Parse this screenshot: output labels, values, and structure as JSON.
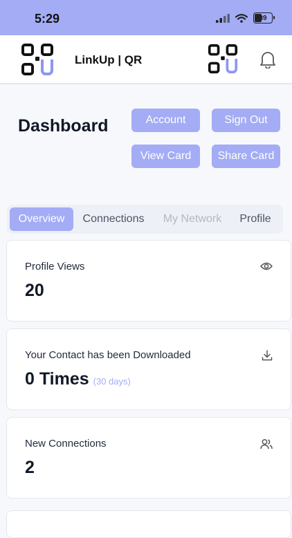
{
  "status_bar": {
    "time": "5:29",
    "battery": "39"
  },
  "header": {
    "title": "LinkUp | QR"
  },
  "dashboard": {
    "title": "Dashboard",
    "buttons": {
      "account": "Account",
      "sign_out": "Sign Out",
      "view_card": "View Card",
      "share_card": "Share Card"
    }
  },
  "tabs": [
    {
      "label": "Overview"
    },
    {
      "label": "Connections"
    },
    {
      "label": "My Network"
    },
    {
      "label": "Profile"
    }
  ],
  "cards": [
    {
      "label": "Profile Views",
      "value": "20",
      "icon": "eye-icon"
    },
    {
      "label": "Your Contact has been Downloaded",
      "value": "0 Times",
      "sub": "(30 days)",
      "icon": "download-icon"
    },
    {
      "label": "New Connections",
      "value": "2",
      "icon": "users-icon"
    }
  ],
  "colors": {
    "accent": "#a3acf5",
    "status_bar": "#a3acf5"
  },
  "icons": {
    "logo": "qr-logo-icon",
    "notifications": "bell-icon"
  }
}
